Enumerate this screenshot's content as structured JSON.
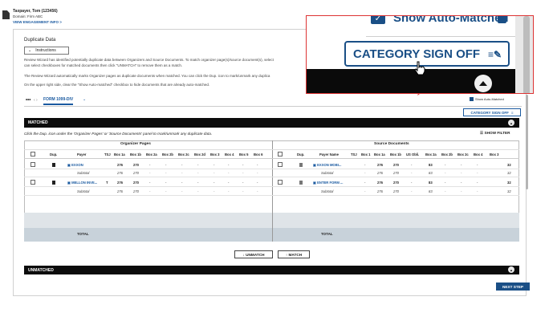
{
  "header": {
    "taxpayer": "Taxpayer, Tom (123456)",
    "domain": "Domain: Firm ABC",
    "engagement_link": "VIEW ENGAGEMENT INFO >"
  },
  "page": {
    "title": "Duplicate Data",
    "instructions_label": "Instructions",
    "para1": "Review Wizard has identified potentially duplicate data between Organizers and Source Documents. To match organizer page(s)/source document(s), select",
    "para1b": "can select checkboxes for matched documents then click \"UNMATCH\" to remove them as a match.",
    "para2": "The Review Wizard automatically marks Organizer pages as duplicate documents when matched. You can click the Dup.   icon to mark/unmark any duplica",
    "para3": "On the upper right side, clear the \"Show Auto-matched\" checkbox to hide documents that are already auto-matched."
  },
  "tabs": {
    "more": "•••",
    "active": "FORM 1099-DIV"
  },
  "toolbar": {
    "show_auto_matched": "Show Auto-Matched",
    "category_sign_off": "CATEGORY SIGN OFF"
  },
  "matched": {
    "bar_label": "MATCHED",
    "hint": "Click the Dup.   icon under the 'Organizer Pages' or 'Source Documents' panel to mark/unmark any duplicate data.",
    "show_filter": "SHOW FILTER",
    "organizer_header": "Organizer Pages",
    "source_header": "Source Documents",
    "org_columns": [
      "Dup.",
      "Payer",
      "TSJ",
      "Box 1a",
      "Box 1b",
      "Box 2a",
      "Box 2b",
      "Box 2c",
      "Box 2d",
      "Box 3",
      "Box 4",
      "Box 5",
      "Box 6"
    ],
    "src_columns": [
      "Dup.",
      "Payer Name",
      "TSJ",
      "Box 1",
      "Box 1a",
      "Box 1b",
      "US Obli.",
      "Box 2a",
      "Box 2b",
      "Box 2c",
      "Box 4",
      "Box 3"
    ],
    "org_rows": [
      {
        "payer": "EXXON",
        "tsj": "",
        "v1a": "276",
        "v1b": "270",
        "rest": [
          "-",
          "-",
          "-",
          "-",
          "-",
          "-",
          "-",
          "-"
        ]
      },
      {
        "payer": "Subtotal",
        "tsj": "",
        "v1a": "276",
        "v1b": "270",
        "rest": [
          "-",
          "-",
          "-",
          "-",
          "-",
          "-",
          "-",
          "-"
        ]
      },
      {
        "payer": "MELLON INVE...",
        "tsj": "T",
        "v1a": "276",
        "v1b": "270",
        "rest": [
          "-",
          "-",
          "-",
          "-",
          "-",
          "-",
          "-",
          "-"
        ]
      },
      {
        "payer": "Subtotal",
        "tsj": "",
        "v1a": "276",
        "v1b": "270",
        "rest": [
          "-",
          "-",
          "-",
          "-",
          "-",
          "-",
          "-",
          "-"
        ]
      }
    ],
    "src_rows": [
      {
        "payer": "EXXON MOBI...",
        "tsj": "",
        "b1": "-",
        "b1a": "276",
        "b1b": "270",
        "us": "-",
        "b2a": "83",
        "b2b": "-",
        "b2c": "-",
        "b4": "-",
        "b3": "32"
      },
      {
        "payer": "Subtotal",
        "tsj": "",
        "b1": "-",
        "b1a": "276",
        "b1b": "270",
        "us": "-",
        "b2a": "83",
        "b2b": "-",
        "b2c": "-",
        "b4": "-",
        "b3": "32"
      },
      {
        "payer": "ENTER FORM ...",
        "tsj": "",
        "b1": "-",
        "b1a": "276",
        "b1b": "270",
        "us": "-",
        "b2a": "83",
        "b2b": "-",
        "b2c": "-",
        "b4": "-",
        "b3": "32"
      },
      {
        "payer": "Subtotal",
        "tsj": "",
        "b1": "-",
        "b1a": "276",
        "b1b": "270",
        "us": "-",
        "b2a": "83",
        "b2b": "-",
        "b2c": "-",
        "b4": "-",
        "b3": "32"
      }
    ],
    "total_label": "TOTAL",
    "unmatch_label": "UNMATCH",
    "match_label": "MATCH"
  },
  "unmatched": {
    "bar_label": "UNMATCHED"
  },
  "footer": {
    "next_step": "NEXT STEP"
  },
  "colors": {
    "brand_blue": "#1a4f86",
    "callout_red": "#dd3333"
  }
}
